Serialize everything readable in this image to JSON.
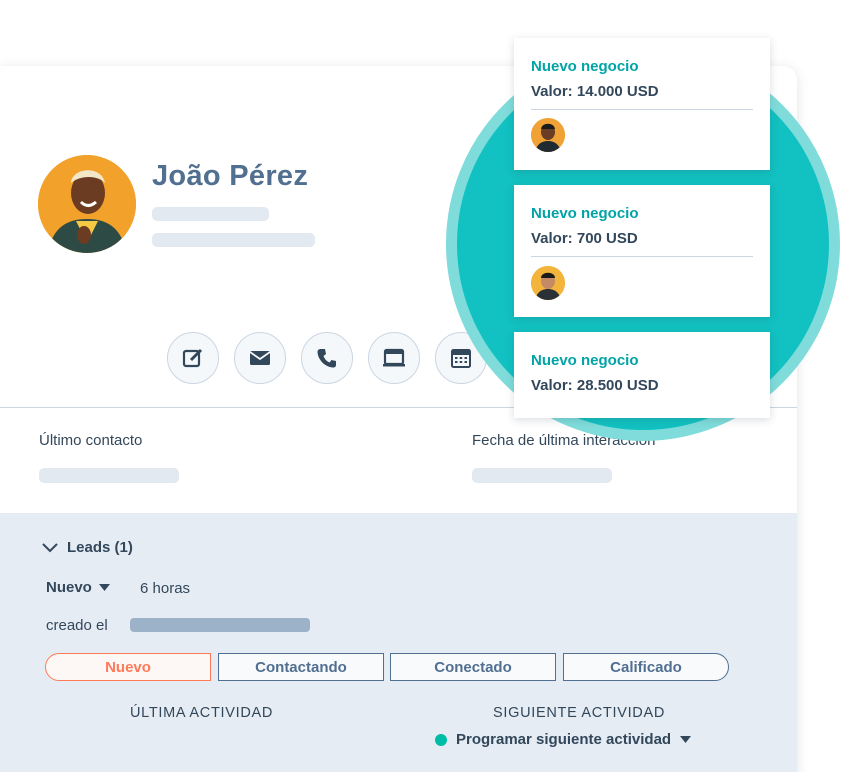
{
  "contact": {
    "name": "João Pérez"
  },
  "actions": [
    {
      "icon": "edit-note-icon"
    },
    {
      "icon": "email-icon"
    },
    {
      "icon": "phone-icon"
    },
    {
      "icon": "meeting-icon"
    },
    {
      "icon": "calendar-icon"
    }
  ],
  "fields": {
    "last_contact_label": "Último contacto",
    "last_interaction_label": "Fecha de última interacción"
  },
  "leads": {
    "header": "Leads (1)",
    "status": "Nuevo",
    "age": "6 horas",
    "created_label": "creado el",
    "stages": [
      "Nuevo",
      "Contactando",
      "Conectado",
      "Calificado"
    ],
    "active_stage": "Nuevo",
    "last_activity_label": "ÚLTIMA ACTIVIDAD",
    "next_activity_label": "SIGUIENTE ACTIVIDAD",
    "schedule_label": "Programar siguiente actividad"
  },
  "deals": [
    {
      "title": "Nuevo negocio",
      "value": "Valor: 14.000 USD"
    },
    {
      "title": "Nuevo negocio",
      "value": "Valor: 700 USD"
    },
    {
      "title": "Nuevo negocio",
      "value": "Valor: 28.500 USD"
    }
  ],
  "colors": {
    "accent": "#00a4a6",
    "circle": "#12c1c1",
    "active_stage": "#ff7a59",
    "text": "#33475b",
    "muted": "#516f90"
  }
}
